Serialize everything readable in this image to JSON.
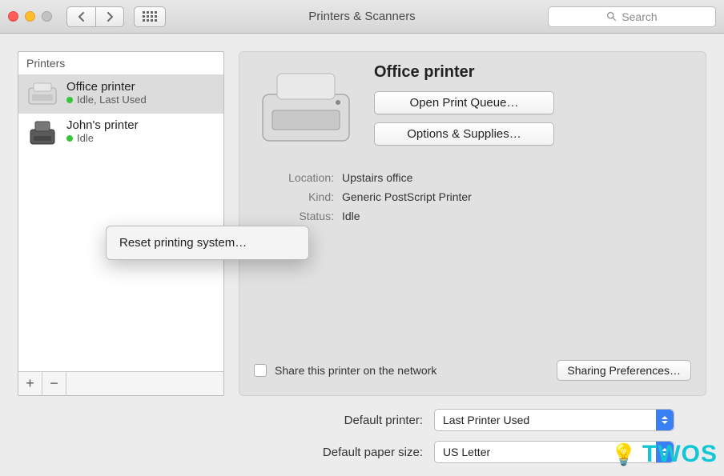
{
  "titlebar": {
    "title": "Printers & Scanners",
    "search_placeholder": "Search"
  },
  "sidebar": {
    "header": "Printers",
    "items": [
      {
        "name": "Office printer",
        "status": "Idle, Last Used",
        "selected": true
      },
      {
        "name": "John's printer",
        "status": "Idle",
        "selected": false
      }
    ]
  },
  "context_menu": {
    "label": "Reset printing system…"
  },
  "detail": {
    "title": "Office printer",
    "open_queue_label": "Open Print Queue…",
    "options_supplies_label": "Options & Supplies…",
    "location_label": "Location:",
    "location_value": "Upstairs office",
    "kind_label": "Kind:",
    "kind_value": "Generic PostScript Printer",
    "status_label": "Status:",
    "status_value": "Idle",
    "share_label": "Share this printer on the network",
    "sharing_prefs_label": "Sharing Preferences…"
  },
  "bottom": {
    "default_printer_label": "Default printer:",
    "default_printer_value": "Last Printer Used",
    "default_paper_label": "Default paper size:",
    "default_paper_value": "US Letter"
  },
  "watermark": {
    "text": "TWOS"
  }
}
